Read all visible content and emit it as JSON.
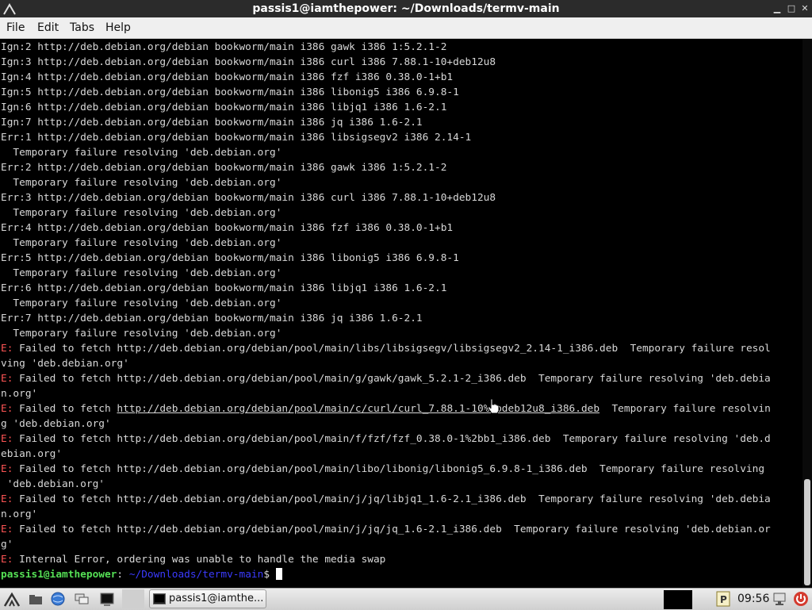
{
  "window": {
    "title": "passis1@iamthepower: ~/Downloads/termv-main"
  },
  "menu": [
    "File",
    "Edit",
    "Tabs",
    "Help"
  ],
  "terminal": {
    "lines": [
      "Ign:2 http://deb.debian.org/debian bookworm/main i386 gawk i386 1:5.2.1-2",
      "Ign:3 http://deb.debian.org/debian bookworm/main i386 curl i386 7.88.1-10+deb12u8",
      "Ign:4 http://deb.debian.org/debian bookworm/main i386 fzf i386 0.38.0-1+b1",
      "Ign:5 http://deb.debian.org/debian bookworm/main i386 libonig5 i386 6.9.8-1",
      "Ign:6 http://deb.debian.org/debian bookworm/main i386 libjq1 i386 1.6-2.1",
      "Ign:7 http://deb.debian.org/debian bookworm/main i386 jq i386 1.6-2.1",
      "Err:1 http://deb.debian.org/debian bookworm/main i386 libsigsegv2 i386 2.14-1",
      "  Temporary failure resolving 'deb.debian.org'",
      "Err:2 http://deb.debian.org/debian bookworm/main i386 gawk i386 1:5.2.1-2",
      "  Temporary failure resolving 'deb.debian.org'",
      "Err:3 http://deb.debian.org/debian bookworm/main i386 curl i386 7.88.1-10+deb12u8",
      "  Temporary failure resolving 'deb.debian.org'",
      "Err:4 http://deb.debian.org/debian bookworm/main i386 fzf i386 0.38.0-1+b1",
      "  Temporary failure resolving 'deb.debian.org'",
      "Err:5 http://deb.debian.org/debian bookworm/main i386 libonig5 i386 6.9.8-1",
      "  Temporary failure resolving 'deb.debian.org'",
      "Err:6 http://deb.debian.org/debian bookworm/main i386 libjq1 i386 1.6-2.1",
      "  Temporary failure resolving 'deb.debian.org'",
      "Err:7 http://deb.debian.org/debian bookworm/main i386 jq i386 1.6-2.1",
      "  Temporary failure resolving 'deb.debian.org'"
    ],
    "error_prefix": "E:",
    "error_lines": [
      {
        "text": " Failed to fetch http://deb.debian.org/debian/pool/main/libs/libsigsegv/libsigsegv2_2.14-1_i386.deb  Temporary failure resol",
        "cont": "ving 'deb.debian.org'"
      },
      {
        "text": " Failed to fetch http://deb.debian.org/debian/pool/main/g/gawk/gawk_5.2.1-2_i386.deb  Temporary failure resolving 'deb.debia",
        "cont": "n.org'"
      },
      {
        "pre": " Failed to fetch ",
        "link": "http://deb.debian.org/debian/pool/main/c/curl/curl_7.88.1-10%2bdeb12u8_i386.deb",
        "post": "  Temporary failure resolvin",
        "cont": "g 'deb.debian.org'"
      },
      {
        "text": " Failed to fetch http://deb.debian.org/debian/pool/main/f/fzf/fzf_0.38.0-1%2bb1_i386.deb  Temporary failure resolving 'deb.d",
        "cont": "ebian.org'"
      },
      {
        "text": " Failed to fetch http://deb.debian.org/debian/pool/main/libo/libonig/libonig5_6.9.8-1_i386.deb  Temporary failure resolving",
        "cont": " 'deb.debian.org'"
      },
      {
        "text": " Failed to fetch http://deb.debian.org/debian/pool/main/j/jq/libjq1_1.6-2.1_i386.deb  Temporary failure resolving 'deb.debia",
        "cont": "n.org'"
      },
      {
        "text": " Failed to fetch http://deb.debian.org/debian/pool/main/j/jq/jq_1.6-2.1_i386.deb  Temporary failure resolving 'deb.debian.or",
        "cont": "g'"
      },
      {
        "text": " Internal Error, ordering was unable to handle the media swap"
      }
    ],
    "prompt": {
      "user": "passis1@iamthepower",
      "separator": ":",
      "path": " ~/Downloads/termv-main",
      "symbol": "$ "
    }
  },
  "taskbar": {
    "task_label": "passis1@iamthe...",
    "clock": "09:56"
  },
  "colors": {
    "error": "#ff5555",
    "prompt_user": "#55e055",
    "prompt_path": "#3b3bff",
    "text": "#d8d8d8"
  }
}
